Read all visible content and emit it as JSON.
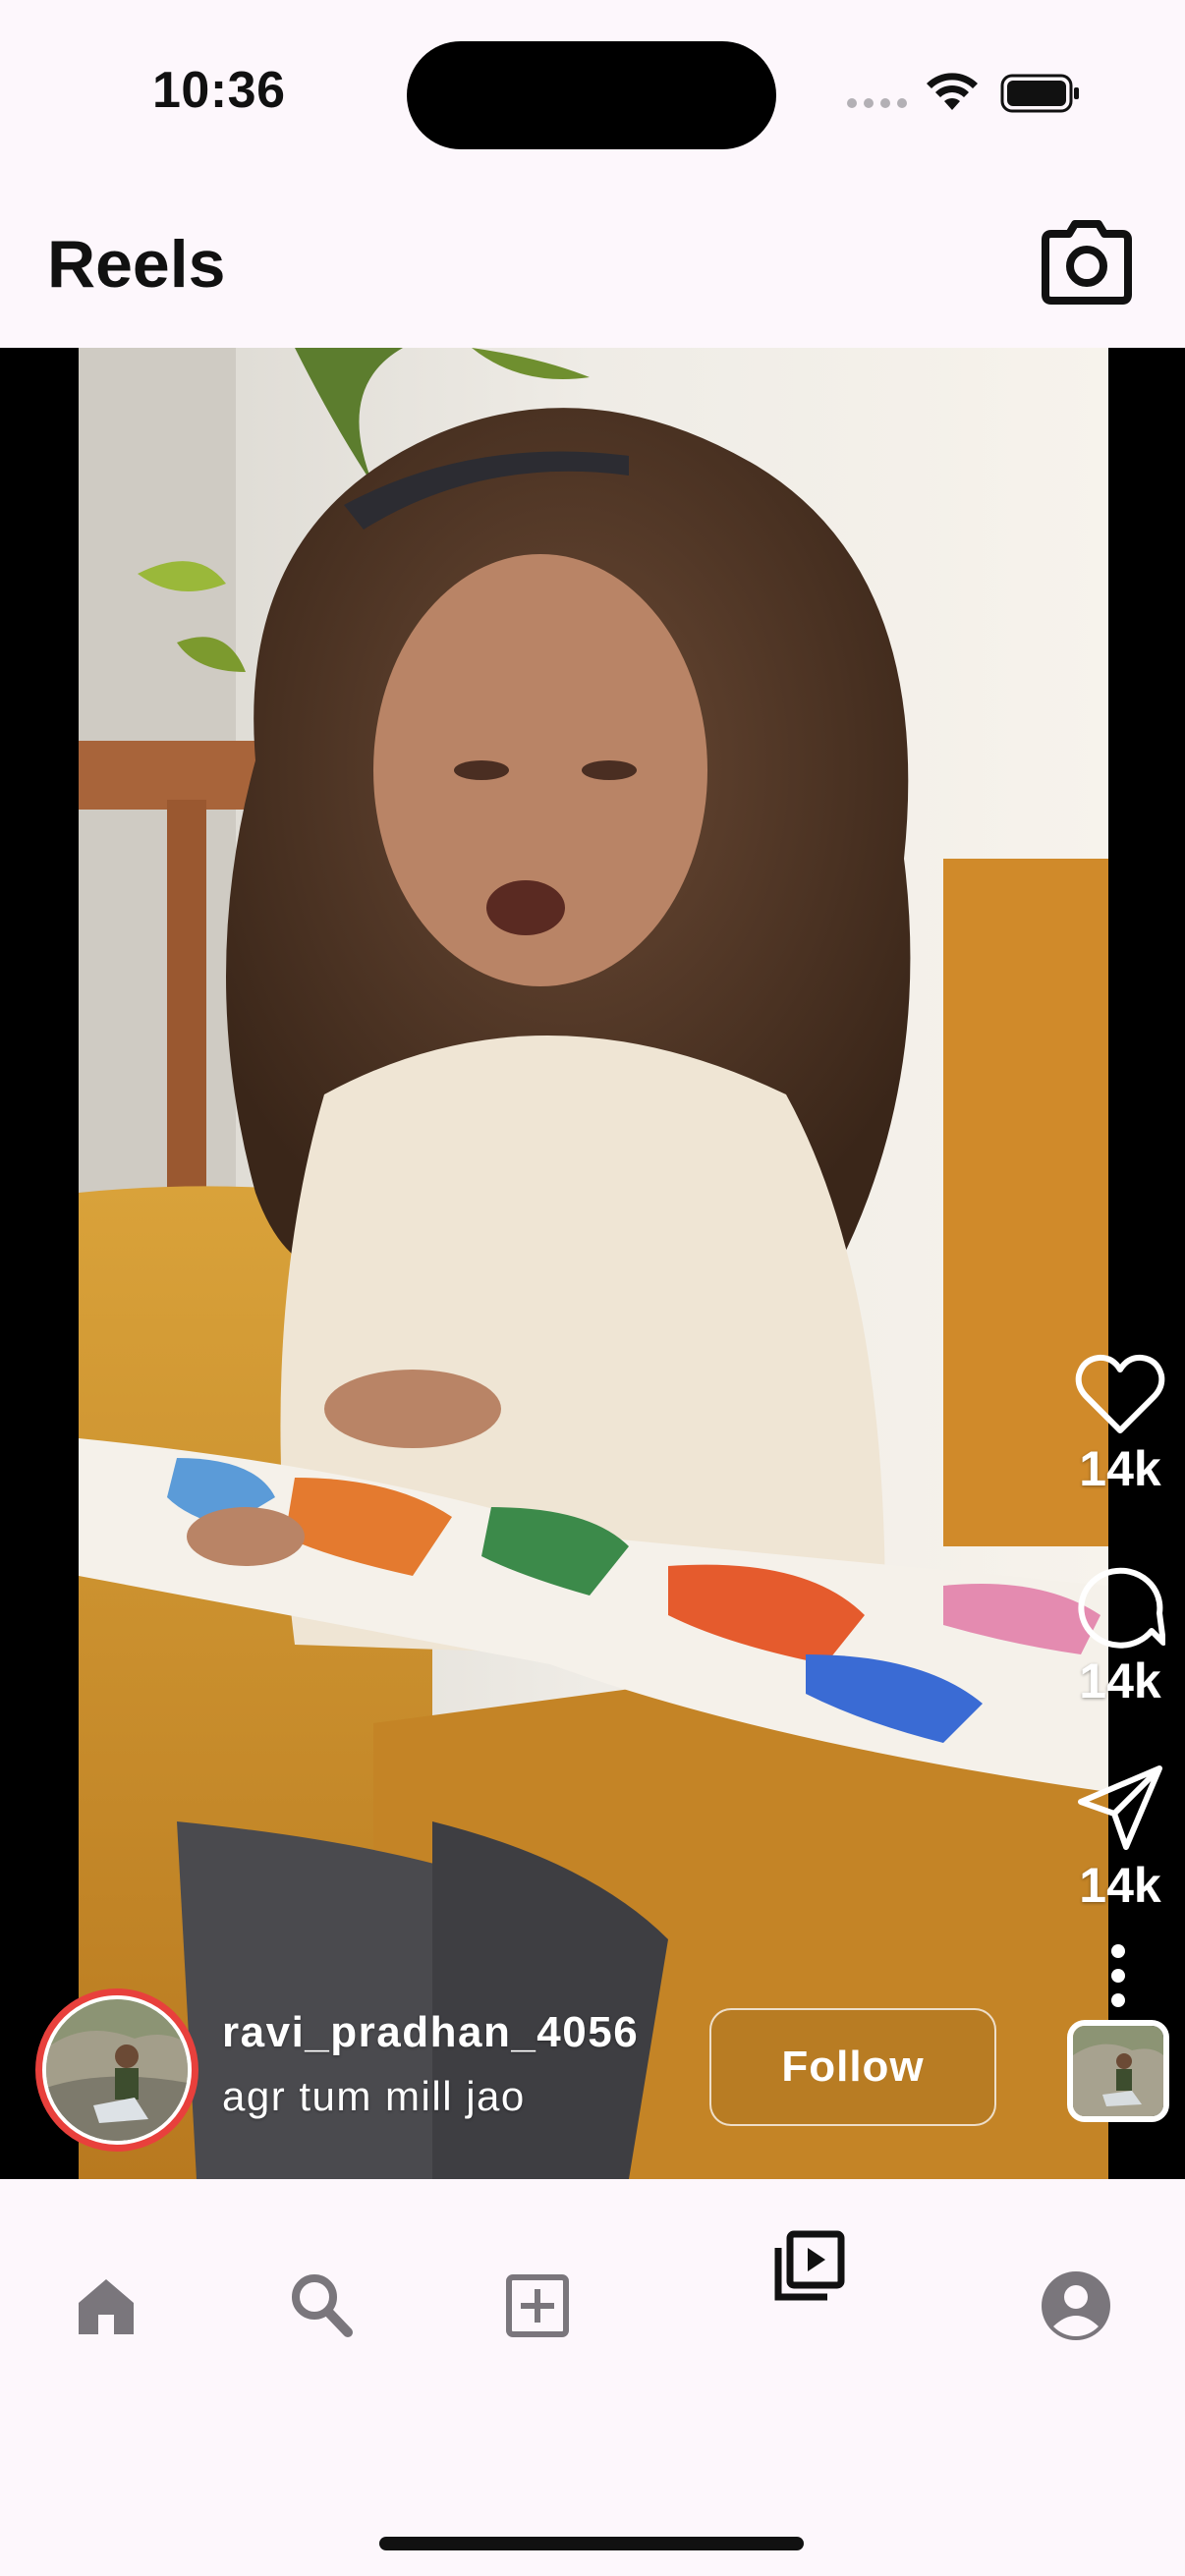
{
  "status_bar": {
    "time": "10:36"
  },
  "header": {
    "title": "Reels"
  },
  "actions": {
    "likes": "14k",
    "comments": "14k",
    "shares": "14k"
  },
  "creator": {
    "username": "ravi_pradhan_4056",
    "caption": "agr tum mill jao",
    "follow_label": "Follow",
    "ring_color": "#e8403c"
  },
  "nav": {
    "items": [
      "home-icon",
      "search-icon",
      "add-box-icon",
      "reels-icon",
      "profile-icon"
    ],
    "active": "reels-icon"
  },
  "colors": {
    "background": "#fdf7fc",
    "nav_icon": "#7a767c",
    "text_dark": "#111111"
  }
}
